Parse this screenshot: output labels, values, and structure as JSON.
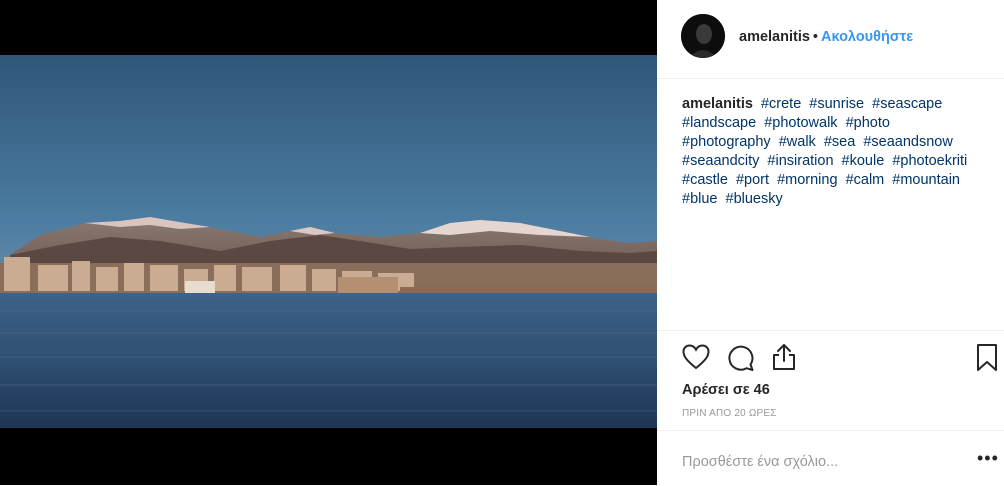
{
  "post": {
    "username": "amelanitis",
    "separator": "•",
    "follow_label": "Ακολουθήστε",
    "caption": {
      "username": "amelanitis",
      "hashtags": [
        "#crete",
        "#sunrise",
        "#seascape",
        "#landscape",
        "#photowalk",
        "#photo",
        "#photography",
        "#walk",
        "#sea",
        "#seaandsnow",
        "#seaandcity",
        "#insiration",
        "#koule",
        "#photoekriti",
        "#castle",
        "#port",
        "#morning",
        "#calm",
        "#mountain",
        "#blue",
        "#bluesky"
      ]
    },
    "likes_text": "Αρέσει σε 46",
    "timestamp": "ΠΡΙΝ ΑΠΟ 20 ΩΡΕΣ",
    "comment_placeholder": "Προσθέστε ένα σχόλιο...",
    "more_label": "•••"
  },
  "icons": {
    "like": "heart-icon",
    "comment": "comment-icon",
    "share": "share-icon",
    "save": "bookmark-icon"
  },
  "colors": {
    "follow": "#3897f0",
    "hashtag": "#003569",
    "text": "#262626",
    "muted": "#999999"
  }
}
